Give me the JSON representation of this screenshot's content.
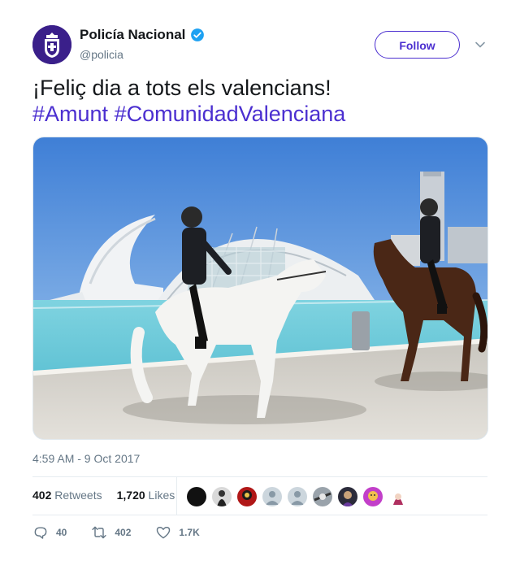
{
  "account": {
    "name": "Policía Nacional",
    "handle": "@policia",
    "verified": true,
    "brand_color": "#3a1f8a"
  },
  "follow_label": "Follow",
  "tweet": {
    "text": "¡Feliç dia a tots els valencians!",
    "hashtags": [
      "#Amunt",
      "#ComunidadValenciana"
    ],
    "link_color": "#4b2fd0"
  },
  "timestamp": "4:59 AM - 9 Oct 2017",
  "stats": {
    "retweets_count": "402",
    "retweets_label": "Retweets",
    "likes_count": "1,720",
    "likes_label": "Likes"
  },
  "actions": {
    "replies": "40",
    "retweets": "402",
    "likes": "1.7K"
  },
  "icons": [
    "verified-badge-icon",
    "chevron-down-icon",
    "reply-icon",
    "retweet-icon",
    "like-icon"
  ]
}
